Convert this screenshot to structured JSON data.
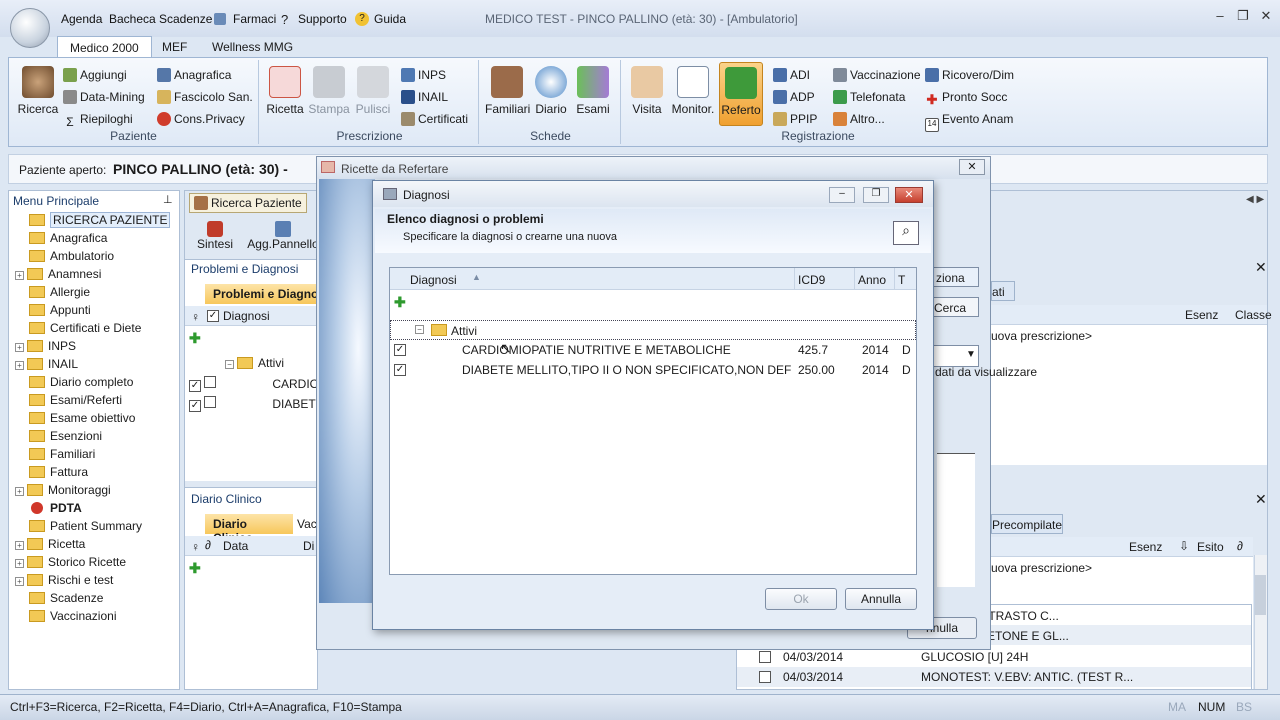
{
  "window": {
    "title": "MEDICO TEST - PINCO PALLINO (età: 30)   - [Ambulatorio]",
    "quick_menu": [
      "Agenda",
      "Bacheca",
      "Scadenze",
      "Farmaci",
      "Supporto",
      "Guida"
    ]
  },
  "ribbon_tabs": [
    "Medico 2000",
    "MEF",
    "Wellness MMG"
  ],
  "ribbon": {
    "paziente": {
      "title": "Paziente",
      "big": "Ricerca",
      "small": [
        "Aggiungi",
        "Data-Mining",
        "Riepiloghi",
        "Anagrafica",
        "Fascicolo San.",
        "Cons.Privacy"
      ]
    },
    "prescrizione": {
      "title": "Prescrizione",
      "big": [
        "Ricetta",
        "Stampa",
        "Pulisci"
      ],
      "small": [
        "INPS",
        "INAIL",
        "Certificati"
      ]
    },
    "schede": {
      "title": "Schede",
      "big": [
        "Familiari",
        "Diario",
        "Esami"
      ]
    },
    "registrazione": {
      "title": "Registrazione",
      "big": [
        "Visita",
        "Monitor.",
        "Referto"
      ],
      "small": [
        "ADI",
        "ADP",
        "PPIP",
        "Vaccinazione",
        "Telefonata",
        "Altro...",
        "Ricovero/Dim",
        "Pronto Socc",
        "Evento Anam"
      ]
    }
  },
  "patient_bar": {
    "label": "Paziente aperto:",
    "name": "PINCO PALLINO (età: 30) -"
  },
  "left_menu": {
    "title": "Menu Principale",
    "items": [
      "RICERCA PAZIENTE",
      "Anagrafica",
      "Ambulatorio",
      "Anamnesi",
      "Allergie",
      "Appunti",
      "Certificati e Diete",
      "INPS",
      "INAIL",
      "Diario completo",
      "Esami/Referti",
      "Esame obiettivo",
      "Esenzioni",
      "Familiari",
      "Fattura",
      "Monitoraggi",
      "PDTA",
      "Patient Summary",
      "Ricetta",
      "Storico Ricette",
      "Rischi e test",
      "Scadenze",
      "Vaccinazioni"
    ]
  },
  "center": {
    "tab_ricerca": "Ricerca Paziente",
    "tool_sintesi": "Sintesi",
    "tool_agg": "Agg.Pannello",
    "section1": "Problemi e Diagnosi",
    "tab_problemi": "Problemi e Diagnosi",
    "col_diagnosi": "Diagnosi",
    "folder": "Attivi",
    "rows": [
      "CARDIO",
      "DIABETE"
    ],
    "section2": "Diario Clinico",
    "tab_diario": "Diario Clinico",
    "tab_vac": "Vac",
    "col_data": "Data",
    "col_di": "Di"
  },
  "right": {
    "btn_seleziona": "ziona",
    "tab_dati": "ati",
    "btn_cerca": "Cerca",
    "col_esenz": "Esenz",
    "col_classe": "Classe",
    "nuova1": "uova prescrizione>",
    "nodata": "dati da visualizzare",
    "tab_precompilate": "Precompilate",
    "col_esenz2": "Esenz",
    "col_esito": "Esito",
    "nuova2": "uova prescrizione>",
    "rows": [
      {
        "date": "",
        "text": "A CON CONTRASTO C..."
      },
      {
        "date": "",
        "text": "RZIALE (ACETONE E GL..."
      },
      {
        "date": "04/03/2014",
        "text": "GLUCOSIO [U] 24H"
      },
      {
        "date": "04/03/2014",
        "text": "MONOTEST: V.EBV: ANTIC. (TEST R..."
      }
    ],
    "annulla_back": "nnulla"
  },
  "ricette_dialog": {
    "title": "Ricette da Refertare"
  },
  "diagnosi_dialog": {
    "title": "Diagnosi",
    "heading": "Elenco diagnosi o problemi",
    "subheading": "Specificare la diagnosi o crearne una nuova",
    "columns": {
      "diagnosi": "Diagnosi",
      "icd9": "ICD9",
      "anno": "Anno",
      "t": "T"
    },
    "folder": "Attivi",
    "rows": [
      {
        "diagnosi": "CARDIOMIOPATIE NUTRITIVE E METABOLICHE",
        "icd9": "425.7",
        "anno": "2014",
        "t": "D"
      },
      {
        "diagnosi": "DIABETE MELLITO,TIPO II O NON SPECIFICATO,NON DEFINI...",
        "icd9": "250.00",
        "anno": "2014",
        "t": "D"
      }
    ],
    "ok": "Ok",
    "annulla": "Annulla"
  },
  "status_bar": {
    "text": "Ctrl+F3=Ricerca, F2=Ricetta, F4=Diario, Ctrl+A=Anagrafica, F10=Stampa",
    "ma": "MA",
    "num": "NUM",
    "bs": "BS"
  },
  "colors": {
    "accent": "#f0a030",
    "ribbon_bg": "#dfe9f6",
    "folder": "#f2c955"
  }
}
